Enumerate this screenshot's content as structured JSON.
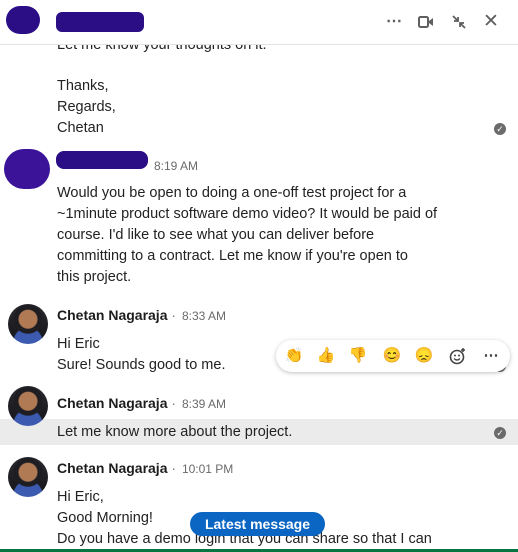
{
  "header": {
    "more_icon": "ellipsis-icon",
    "video_icon": "video-call-icon",
    "minimize_icon": "minimize-icon",
    "close_icon": "close-icon"
  },
  "messages": {
    "m0": {
      "lines": [
        "Let me know your thoughts on it.",
        "",
        "Thanks,",
        "Regards,",
        "Chetan"
      ]
    },
    "m1": {
      "time": "8:19 AM",
      "lines": [
        "Would you be open to doing a one-off test project for a",
        "~1minute product software demo video? It would be paid of",
        "course. I'd like to see what you can deliver before",
        "committing to a contract. Let me know if you're open to",
        "this project."
      ]
    },
    "m2": {
      "sender": "Chetan Nagaraja",
      "separator": "·",
      "time": "8:33 AM",
      "lines": [
        "Hi Eric",
        "Sure! Sounds good to me."
      ]
    },
    "m3": {
      "sender": "Chetan Nagaraja",
      "separator": "·",
      "time": "8:39 AM",
      "lines": [
        "Let me know more about the project."
      ]
    },
    "m4": {
      "sender": "Chetan Nagaraja",
      "separator": "·",
      "time": "10:01 PM",
      "lines": [
        "Hi Eric,",
        "Good Morning!",
        "Do you have a demo login that you can share so that I can"
      ]
    }
  },
  "reactions": [
    "clapping-hands-icon",
    "thumbs-up-icon",
    "thumbs-down-icon",
    "smile-icon",
    "sad-face-icon",
    "add-reaction-icon",
    "more-options-icon"
  ],
  "latest_message_label": "Latest message",
  "colors": {
    "accent": "#0a66c2",
    "redaction": "#2b0d86",
    "bottom_bar": "#057642"
  }
}
